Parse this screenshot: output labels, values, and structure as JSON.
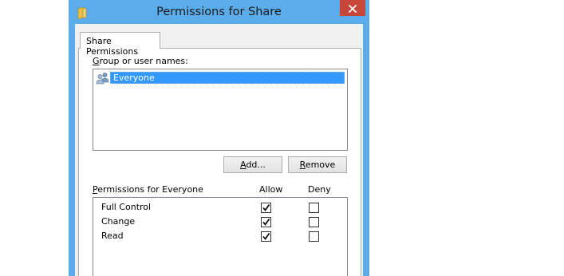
{
  "window": {
    "title": "Permissions for Share",
    "title_bar_color": "#5bacea",
    "close_button_color": "#c7473c"
  },
  "tab": {
    "label": "Share Permissions"
  },
  "group_list": {
    "label": "Group or user names:",
    "label_access_key": "G",
    "label_rest": "roup or user names:",
    "items": [
      {
        "name": "Everyone",
        "selected": true,
        "icon": "users-icon"
      }
    ]
  },
  "buttons": {
    "add_access_key": "A",
    "add_rest": "dd...",
    "remove_access_key": "R",
    "remove_rest": "emove"
  },
  "permissions": {
    "label_access_key": "P",
    "label_rest": "ermissions for Everyone",
    "allow_header": "Allow",
    "deny_header": "Deny",
    "rows": [
      {
        "name": "Full Control",
        "allow": true,
        "deny": false
      },
      {
        "name": "Change",
        "allow": true,
        "deny": false
      },
      {
        "name": "Read",
        "allow": true,
        "deny": false
      }
    ]
  }
}
